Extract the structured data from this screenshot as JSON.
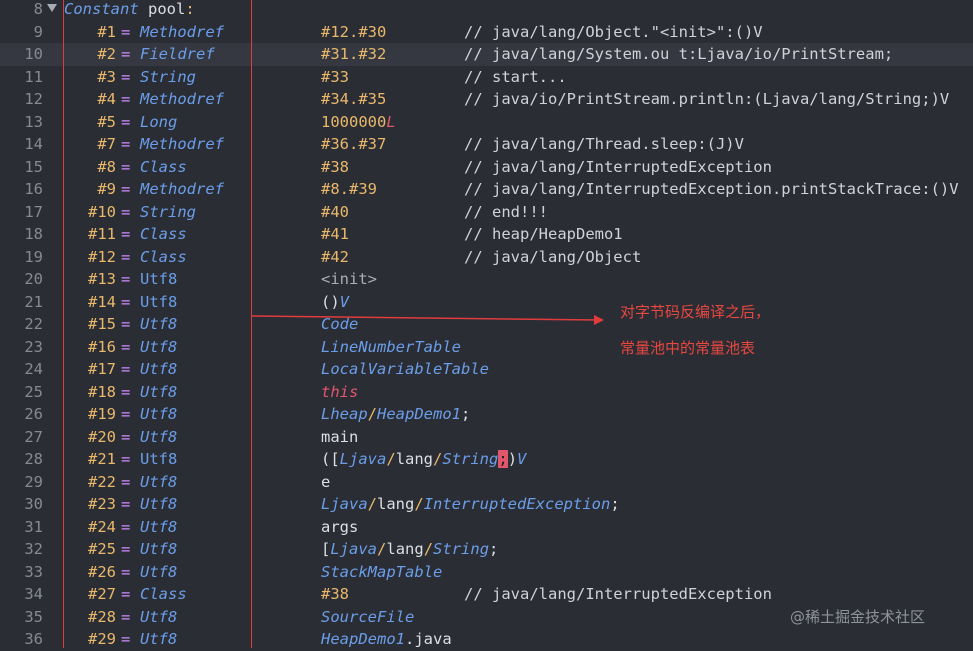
{
  "header": {
    "constant_kw": "Constant",
    "pool_label": "pool",
    "colon": ":"
  },
  "lines": [
    {
      "num": "8"
    },
    {
      "num": "9",
      "idx": "#1",
      "kind": "Methodref",
      "kind_italic": true,
      "ref": "#12.#30",
      "comment": "// java/lang/Object.\"<init>\":()V"
    },
    {
      "num": "10",
      "idx": "#2",
      "kind": "Fieldref",
      "kind_italic": true,
      "ref": "#31.#32",
      "comment": "// java/lang/System.ou t:Ljava/io/PrintStream;"
    },
    {
      "num": "11",
      "idx": "#3",
      "kind": "String",
      "kind_italic": true,
      "ref": "#33",
      "comment": "// start..."
    },
    {
      "num": "12",
      "idx": "#4",
      "kind": "Methodref",
      "kind_italic": true,
      "ref": "#34.#35",
      "comment": "// java/io/PrintStream.println:(Ljava/lang/String;)V"
    },
    {
      "num": "13",
      "idx": "#5",
      "kind": "Long",
      "kind_italic": true,
      "ref": "1000000",
      "ref_suffix": "L",
      "comment": ""
    },
    {
      "num": "14",
      "idx": "#7",
      "kind": "Methodref",
      "kind_italic": true,
      "ref": "#36.#37",
      "comment": "// java/lang/Thread.sleep:(J)V"
    },
    {
      "num": "15",
      "idx": "#8",
      "kind": "Class",
      "kind_italic": true,
      "ref": "#38",
      "comment": "// java/lang/InterruptedException"
    },
    {
      "num": "16",
      "idx": "#9",
      "kind": "Methodref",
      "kind_italic": true,
      "ref": "#8.#39",
      "comment": "// java/lang/InterruptedException.printStackTrace:()V"
    },
    {
      "num": "17",
      "idx": "#10",
      "kind": "String",
      "kind_italic": true,
      "ref": "#40",
      "comment": "// end!!!"
    },
    {
      "num": "18",
      "idx": "#11",
      "kind": "Class",
      "kind_italic": true,
      "ref": "#41",
      "comment": "// heap/HeapDemo1"
    },
    {
      "num": "19",
      "idx": "#12",
      "kind": "Class",
      "kind_italic": true,
      "ref": "#42",
      "comment": "// java/lang/Object"
    },
    {
      "num": "20",
      "idx": "#13",
      "kind": "Utf8",
      "kind_italic": false,
      "ref_html": "init"
    },
    {
      "num": "21",
      "idx": "#14",
      "kind": "Utf8",
      "kind_italic": false,
      "ref_html": "paren"
    },
    {
      "num": "22",
      "idx": "#15",
      "kind": "Utf8",
      "kind_italic": true,
      "ref": "Code",
      "ref_style": "blue-it"
    },
    {
      "num": "23",
      "idx": "#16",
      "kind": "Utf8",
      "kind_italic": true,
      "ref": "LineNumberTable",
      "ref_style": "blue-it"
    },
    {
      "num": "24",
      "idx": "#17",
      "kind": "Utf8",
      "kind_italic": true,
      "ref": "LocalVariableTable",
      "ref_style": "blue-it"
    },
    {
      "num": "25",
      "idx": "#18",
      "kind": "Utf8",
      "kind_italic": true,
      "ref": "this",
      "ref_style": "red-it"
    },
    {
      "num": "26",
      "idx": "#19",
      "kind": "Utf8",
      "kind_italic": true,
      "ref_html": "heapdemo"
    },
    {
      "num": "27",
      "idx": "#20",
      "kind": "Utf8",
      "kind_italic": true,
      "ref": "main",
      "ref_style": "white"
    },
    {
      "num": "28",
      "idx": "#21",
      "kind": "Utf8",
      "kind_italic": false,
      "ref_html": "mainsig"
    },
    {
      "num": "29",
      "idx": "#22",
      "kind": "Utf8",
      "kind_italic": true,
      "ref": "e",
      "ref_style": "white"
    },
    {
      "num": "30",
      "idx": "#23",
      "kind": "Utf8",
      "kind_italic": true,
      "ref_html": "interrupted"
    },
    {
      "num": "31",
      "idx": "#24",
      "kind": "Utf8",
      "kind_italic": true,
      "ref": "args",
      "ref_style": "white"
    },
    {
      "num": "32",
      "idx": "#25",
      "kind": "Utf8",
      "kind_italic": true,
      "ref_html": "strarr"
    },
    {
      "num": "33",
      "idx": "#26",
      "kind": "Utf8",
      "kind_italic": true,
      "ref": "StackMapTable",
      "ref_style": "blue-it"
    },
    {
      "num": "34",
      "idx": "#27",
      "kind": "Class",
      "kind_italic": true,
      "ref": "#38",
      "comment": "// java/lang/InterruptedException"
    },
    {
      "num": "35",
      "idx": "#28",
      "kind": "Utf8",
      "kind_italic": true,
      "ref": "SourceFile",
      "ref_style": "blue-it"
    },
    {
      "num": "36",
      "idx": "#29",
      "kind": "Utf8",
      "kind_italic": true,
      "ref_html": "heapdemojava"
    }
  ],
  "fragments": {
    "init": "<init>",
    "paren_open": "()",
    "paren_v": "V",
    "heap_l": "Lheap",
    "slash": "/",
    "heapdemo": "HeapDemo1",
    "semi": ";",
    "ljava": "Ljava",
    "lang": "lang",
    "string": "String",
    "v": "V",
    "open_bracket": "([",
    "interrupted": "InterruptedException",
    "bracket": "[",
    "heapdemo_java_a": "HeapDemo1",
    "heapdemo_java_b": ".java",
    "close_paren": ")"
  },
  "annotation": {
    "line1": "对字节码反编译之后，",
    "line2": "常量池中的常量池表"
  },
  "watermark": "@稀土掘金技术社区",
  "colors": {
    "background": "#2b2d35",
    "annotation_red": "#e8473f",
    "box_red": "#e03c3c"
  }
}
